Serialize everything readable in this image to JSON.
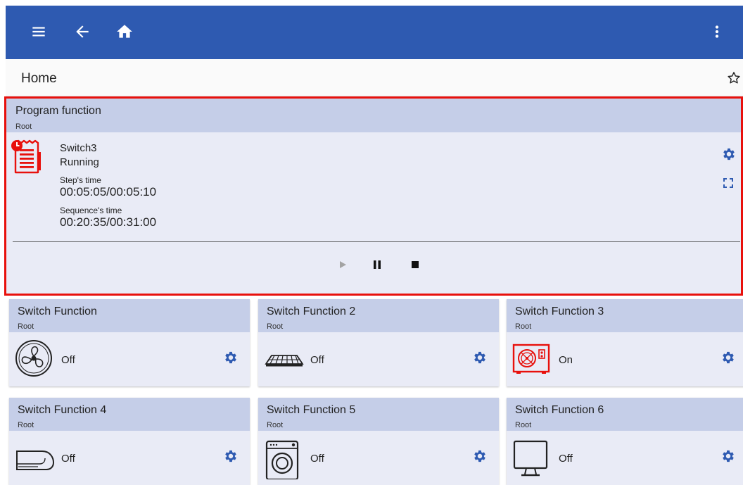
{
  "header": {
    "icons": [
      "menu-icon",
      "back-arrow-icon",
      "home-icon",
      "more-vert-icon"
    ],
    "color": "#2e5ab1"
  },
  "subbar": {
    "title": "Home",
    "favorite_icon": "star-outline-icon"
  },
  "program": {
    "title": "Program function",
    "path": "Root",
    "name": "Switch3",
    "status": "Running",
    "step_label": "Step's time",
    "step_time": "00:05:05/00:05:10",
    "sequence_label": "Sequence's time",
    "sequence_time": "00:20:35/00:31:00",
    "controls": [
      "play-icon",
      "pause-icon",
      "stop-icon"
    ],
    "highlight_color": "#e8100c"
  },
  "tiles": [
    {
      "title": "Switch Function",
      "path": "Root",
      "state": "Off",
      "icon": "fan-icon"
    },
    {
      "title": "Switch Function 2",
      "path": "Root",
      "state": "Off",
      "icon": "heater-icon"
    },
    {
      "title": "Switch Function 3",
      "path": "Root",
      "state": "On",
      "icon": "heat-pump-icon"
    },
    {
      "title": "Switch Function 4",
      "path": "Root",
      "state": "Off",
      "icon": "air-conditioner-icon"
    },
    {
      "title": "Switch Function 5",
      "path": "Root",
      "state": "Off",
      "icon": "washing-machine-icon"
    },
    {
      "title": "Switch Function 6",
      "path": "Root",
      "state": "Off",
      "icon": "monitor-icon"
    }
  ],
  "colors": {
    "accent": "#2e5ab1",
    "card": "#e9ebf6",
    "card_header": "#c5cee8",
    "active": "#e8100c"
  }
}
